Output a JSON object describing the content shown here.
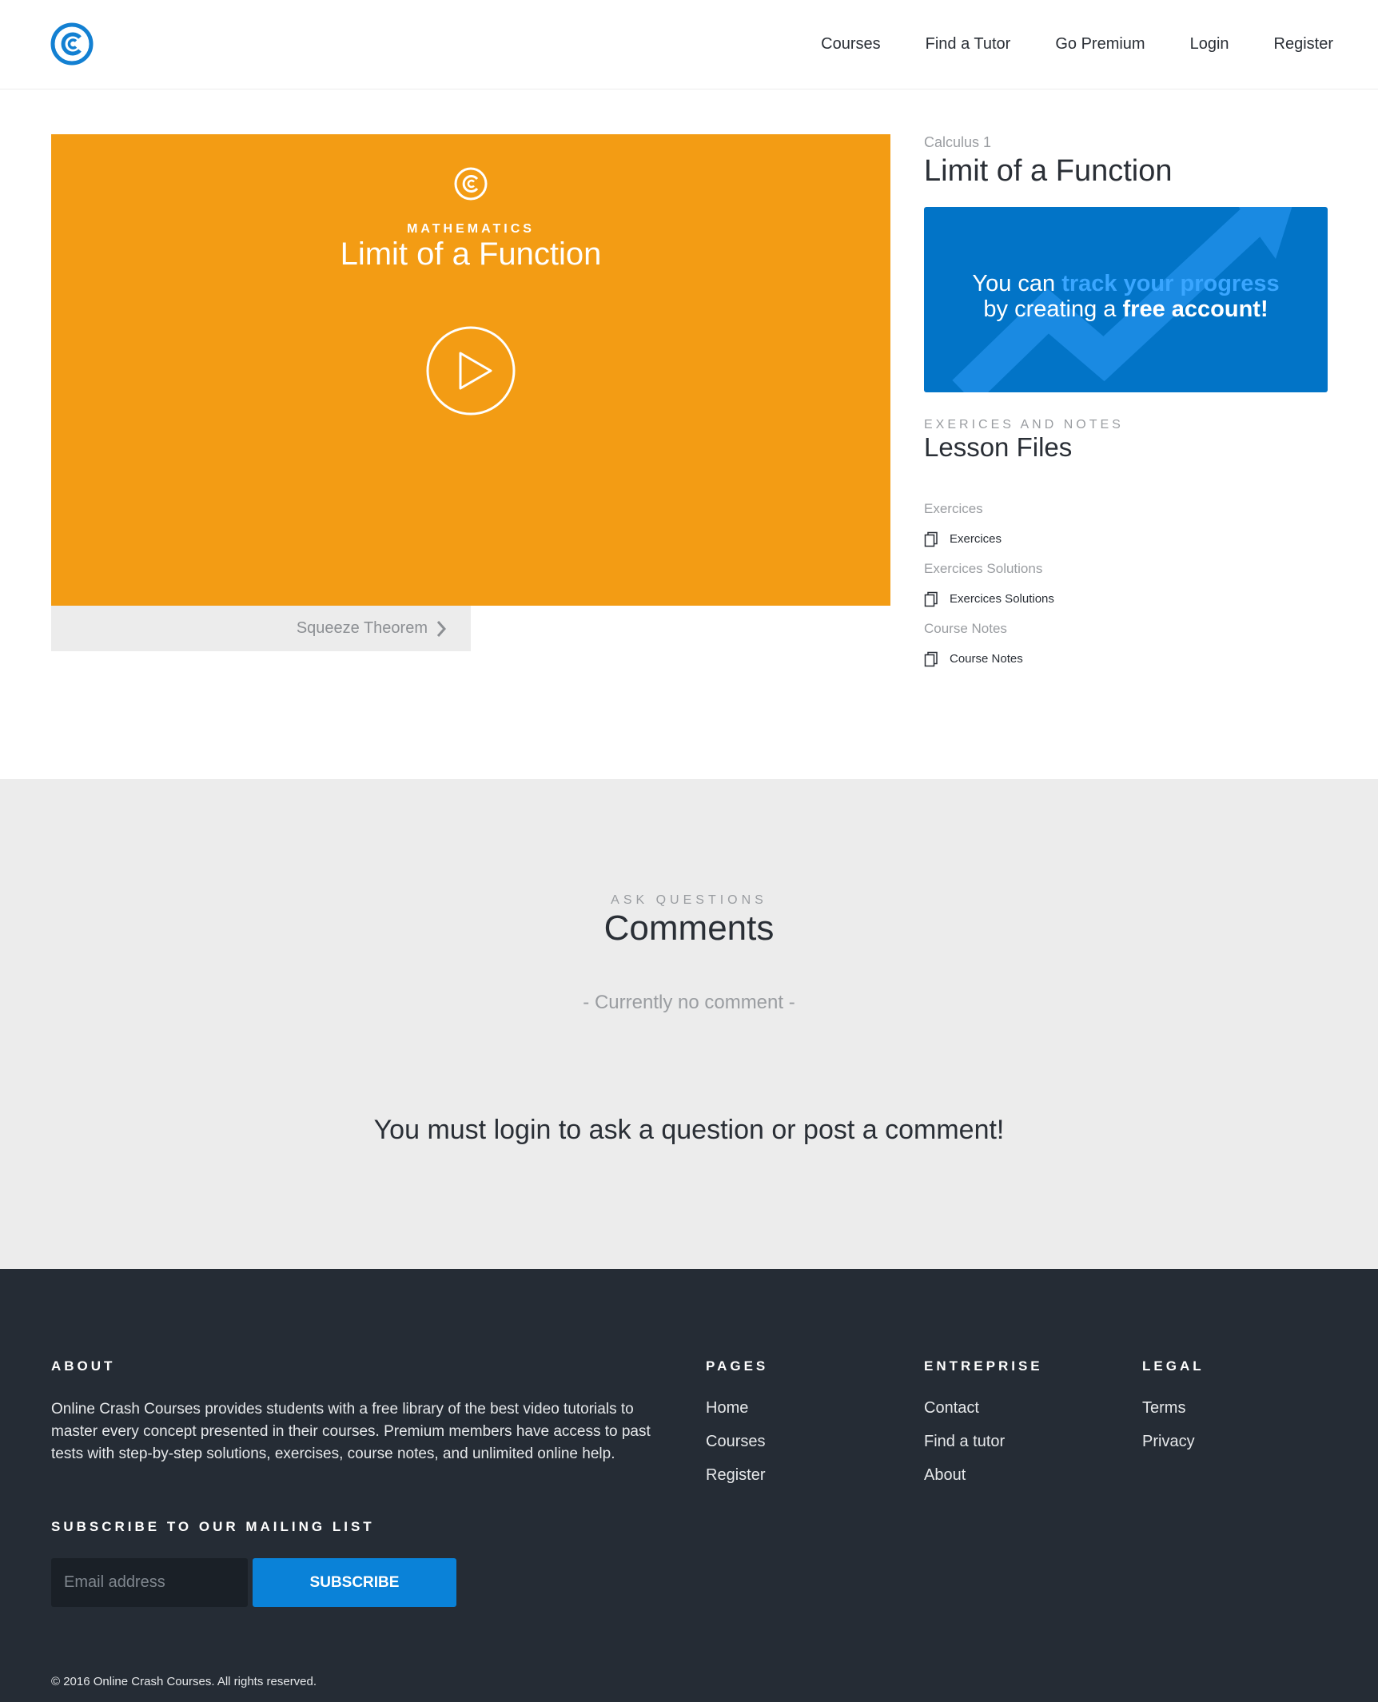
{
  "nav": {
    "items": [
      "Courses",
      "Find a Tutor",
      "Go Premium",
      "Login",
      "Register"
    ]
  },
  "video": {
    "subject": "MATHEMATICS",
    "title": "Limit of a Function"
  },
  "next_lesson": {
    "label": "Squeeze Theorem"
  },
  "sidebar": {
    "course": "Calculus 1",
    "title": "Limit of a Function",
    "promo": {
      "text1": "You can ",
      "highlight": "track your progress",
      "text2": "by creating a ",
      "strong": "free account!"
    },
    "files_kicker": "EXERICES AND NOTES",
    "files_title": "Lesson Files",
    "files": [
      {
        "group": "Exercices",
        "link": "Exercices"
      },
      {
        "group": "Exercices Solutions",
        "link": "Exercices Solutions"
      },
      {
        "group": "Course Notes",
        "link": "Course Notes"
      }
    ]
  },
  "comments": {
    "kicker": "ASK QUESTIONS",
    "title": "Comments",
    "empty": "- Currently no comment -",
    "login_prompt": "You must login to ask a question or post a comment!"
  },
  "footer": {
    "about_heading": "ABOUT",
    "about_text": "Online Crash Courses provides students with a free library of the best video tutorials to master every concept presented in their courses. Premium members have access to past tests with step-by-step solutions, exercises, course notes, and unlimited online help.",
    "subscribe_heading": "SUBSCRIBE TO OUR MAILING LIST",
    "email_placeholder": "Email address",
    "subscribe_label": "SUBSCRIBE",
    "pages_heading": "PAGES",
    "pages": [
      "Home",
      "Courses",
      "Register"
    ],
    "entreprise_heading": "ENTREPRISE",
    "entreprise": [
      "Contact",
      "Find a tutor",
      "About"
    ],
    "legal_heading": "LEGAL",
    "legal": [
      "Terms",
      "Privacy"
    ],
    "copyright": "© 2016 Online Crash Courses. All rights reserved."
  },
  "colors": {
    "brand_blue": "#0274c7",
    "video_orange": "#f39c14",
    "footer_bg": "#252c35",
    "comments_bg": "#ececec"
  }
}
